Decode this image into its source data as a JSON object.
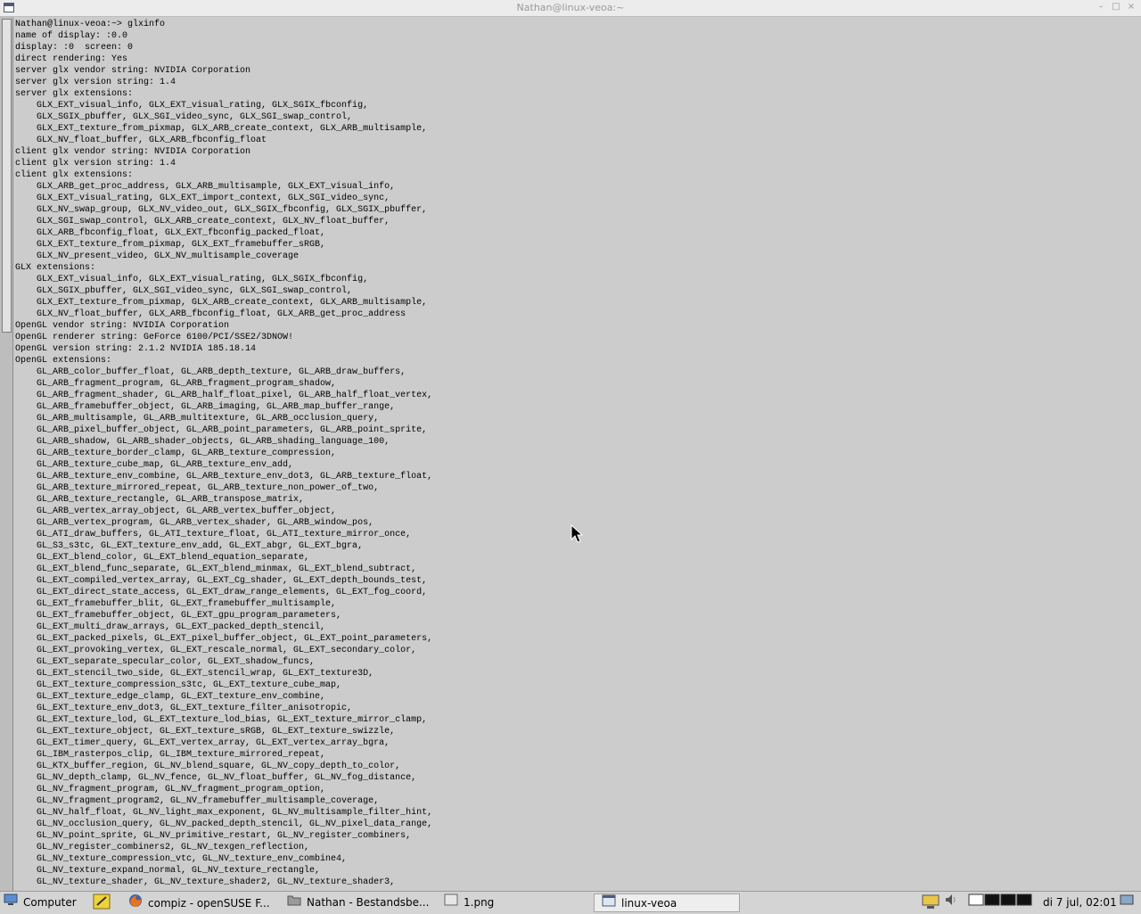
{
  "window": {
    "title": "Nathan@linux-veoa:~"
  },
  "terminal": {
    "lines": [
      "Nathan@linux-veoa:~> glxinfo",
      "name of display: :0.0",
      "display: :0  screen: 0",
      "direct rendering: Yes",
      "server glx vendor string: NVIDIA Corporation",
      "server glx version string: 1.4",
      "server glx extensions:",
      "    GLX_EXT_visual_info, GLX_EXT_visual_rating, GLX_SGIX_fbconfig,",
      "    GLX_SGIX_pbuffer, GLX_SGI_video_sync, GLX_SGI_swap_control,",
      "    GLX_EXT_texture_from_pixmap, GLX_ARB_create_context, GLX_ARB_multisample,",
      "    GLX_NV_float_buffer, GLX_ARB_fbconfig_float",
      "client glx vendor string: NVIDIA Corporation",
      "client glx version string: 1.4",
      "client glx extensions:",
      "    GLX_ARB_get_proc_address, GLX_ARB_multisample, GLX_EXT_visual_info,",
      "    GLX_EXT_visual_rating, GLX_EXT_import_context, GLX_SGI_video_sync,",
      "    GLX_NV_swap_group, GLX_NV_video_out, GLX_SGIX_fbconfig, GLX_SGIX_pbuffer,",
      "    GLX_SGI_swap_control, GLX_ARB_create_context, GLX_NV_float_buffer,",
      "    GLX_ARB_fbconfig_float, GLX_EXT_fbconfig_packed_float,",
      "    GLX_EXT_texture_from_pixmap, GLX_EXT_framebuffer_sRGB,",
      "    GLX_NV_present_video, GLX_NV_multisample_coverage",
      "GLX extensions:",
      "    GLX_EXT_visual_info, GLX_EXT_visual_rating, GLX_SGIX_fbconfig,",
      "    GLX_SGIX_pbuffer, GLX_SGI_video_sync, GLX_SGI_swap_control,",
      "    GLX_EXT_texture_from_pixmap, GLX_ARB_create_context, GLX_ARB_multisample,",
      "    GLX_NV_float_buffer, GLX_ARB_fbconfig_float, GLX_ARB_get_proc_address",
      "OpenGL vendor string: NVIDIA Corporation",
      "OpenGL renderer string: GeForce 6100/PCI/SSE2/3DNOW!",
      "OpenGL version string: 2.1.2 NVIDIA 185.18.14",
      "OpenGL extensions:",
      "    GL_ARB_color_buffer_float, GL_ARB_depth_texture, GL_ARB_draw_buffers,",
      "    GL_ARB_fragment_program, GL_ARB_fragment_program_shadow,",
      "    GL_ARB_fragment_shader, GL_ARB_half_float_pixel, GL_ARB_half_float_vertex,",
      "    GL_ARB_framebuffer_object, GL_ARB_imaging, GL_ARB_map_buffer_range,",
      "    GL_ARB_multisample, GL_ARB_multitexture, GL_ARB_occlusion_query,",
      "    GL_ARB_pixel_buffer_object, GL_ARB_point_parameters, GL_ARB_point_sprite,",
      "    GL_ARB_shadow, GL_ARB_shader_objects, GL_ARB_shading_language_100,",
      "    GL_ARB_texture_border_clamp, GL_ARB_texture_compression,",
      "    GL_ARB_texture_cube_map, GL_ARB_texture_env_add,",
      "    GL_ARB_texture_env_combine, GL_ARB_texture_env_dot3, GL_ARB_texture_float,",
      "    GL_ARB_texture_mirrored_repeat, GL_ARB_texture_non_power_of_two,",
      "    GL_ARB_texture_rectangle, GL_ARB_transpose_matrix,",
      "    GL_ARB_vertex_array_object, GL_ARB_vertex_buffer_object,",
      "    GL_ARB_vertex_program, GL_ARB_vertex_shader, GL_ARB_window_pos,",
      "    GL_ATI_draw_buffers, GL_ATI_texture_float, GL_ATI_texture_mirror_once,",
      "    GL_S3_s3tc, GL_EXT_texture_env_add, GL_EXT_abgr, GL_EXT_bgra,",
      "    GL_EXT_blend_color, GL_EXT_blend_equation_separate,",
      "    GL_EXT_blend_func_separate, GL_EXT_blend_minmax, GL_EXT_blend_subtract,",
      "    GL_EXT_compiled_vertex_array, GL_EXT_Cg_shader, GL_EXT_depth_bounds_test,",
      "    GL_EXT_direct_state_access, GL_EXT_draw_range_elements, GL_EXT_fog_coord,",
      "    GL_EXT_framebuffer_blit, GL_EXT_framebuffer_multisample,",
      "    GL_EXT_framebuffer_object, GL_EXT_gpu_program_parameters,",
      "    GL_EXT_multi_draw_arrays, GL_EXT_packed_depth_stencil,",
      "    GL_EXT_packed_pixels, GL_EXT_pixel_buffer_object, GL_EXT_point_parameters,",
      "    GL_EXT_provoking_vertex, GL_EXT_rescale_normal, GL_EXT_secondary_color,",
      "    GL_EXT_separate_specular_color, GL_EXT_shadow_funcs,",
      "    GL_EXT_stencil_two_side, GL_EXT_stencil_wrap, GL_EXT_texture3D,",
      "    GL_EXT_texture_compression_s3tc, GL_EXT_texture_cube_map,",
      "    GL_EXT_texture_edge_clamp, GL_EXT_texture_env_combine,",
      "    GL_EXT_texture_env_dot3, GL_EXT_texture_filter_anisotropic,",
      "    GL_EXT_texture_lod, GL_EXT_texture_lod_bias, GL_EXT_texture_mirror_clamp,",
      "    GL_EXT_texture_object, GL_EXT_texture_sRGB, GL_EXT_texture_swizzle,",
      "    GL_EXT_timer_query, GL_EXT_vertex_array, GL_EXT_vertex_array_bgra,",
      "    GL_IBM_rasterpos_clip, GL_IBM_texture_mirrored_repeat,",
      "    GL_KTX_buffer_region, GL_NV_blend_square, GL_NV_copy_depth_to_color,",
      "    GL_NV_depth_clamp, GL_NV_fence, GL_NV_float_buffer, GL_NV_fog_distance,",
      "    GL_NV_fragment_program, GL_NV_fragment_program_option,",
      "    GL_NV_fragment_program2, GL_NV_framebuffer_multisample_coverage,",
      "    GL_NV_half_float, GL_NV_light_max_exponent, GL_NV_multisample_filter_hint,",
      "    GL_NV_occlusion_query, GL_NV_packed_depth_stencil, GL_NV_pixel_data_range,",
      "    GL_NV_point_sprite, GL_NV_primitive_restart, GL_NV_register_combiners,",
      "    GL_NV_register_combiners2, GL_NV_texgen_reflection,",
      "    GL_NV_texture_compression_vtc, GL_NV_texture_env_combine4,",
      "    GL_NV_texture_expand_normal, GL_NV_texture_rectangle,",
      "    GL_NV_texture_shader, GL_NV_texture_shader2, GL_NV_texture_shader3,"
    ]
  },
  "taskbar": {
    "menu_label": "Computer",
    "tasks": [
      {
        "label": "compiz - openSUSE F...",
        "icon": "firefox-icon"
      },
      {
        "label": "Nathan - Bestandsbe...",
        "icon": "folder-icon"
      },
      {
        "label": "1.png",
        "icon": "image-icon"
      },
      {
        "label": "linux-veoa",
        "icon": "terminal-icon"
      }
    ],
    "clock": "di 7 jul, 02:01"
  },
  "colors": {
    "terminal_bg": "#cccccc",
    "terminal_fg": "#000000",
    "active_task_bg": "#eeeeee"
  }
}
